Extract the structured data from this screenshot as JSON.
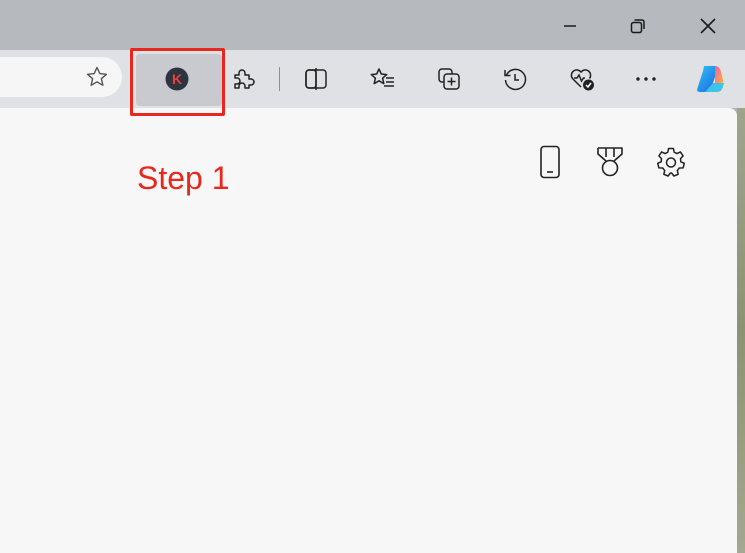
{
  "annotation": {
    "step_label": "Step 1",
    "color": "#e8281e"
  },
  "window": {
    "buttons": [
      {
        "name": "minimize",
        "icon": "minimize-icon"
      },
      {
        "name": "restore",
        "icon": "restore-icon"
      },
      {
        "name": "close",
        "icon": "close-icon"
      }
    ]
  },
  "toolbar": {
    "favorite_icon": "star-icon",
    "extension_letter": "K",
    "items": [
      "extension-k-icon",
      "extensions-puzzle-icon",
      "split-screen-icon",
      "favorites-icon",
      "collections-icon",
      "history-icon",
      "browser-essentials-icon",
      "more-icon",
      "copilot-icon"
    ]
  },
  "content": {
    "icons": [
      "phone-icon",
      "medal-icon",
      "settings-gear-icon"
    ]
  }
}
